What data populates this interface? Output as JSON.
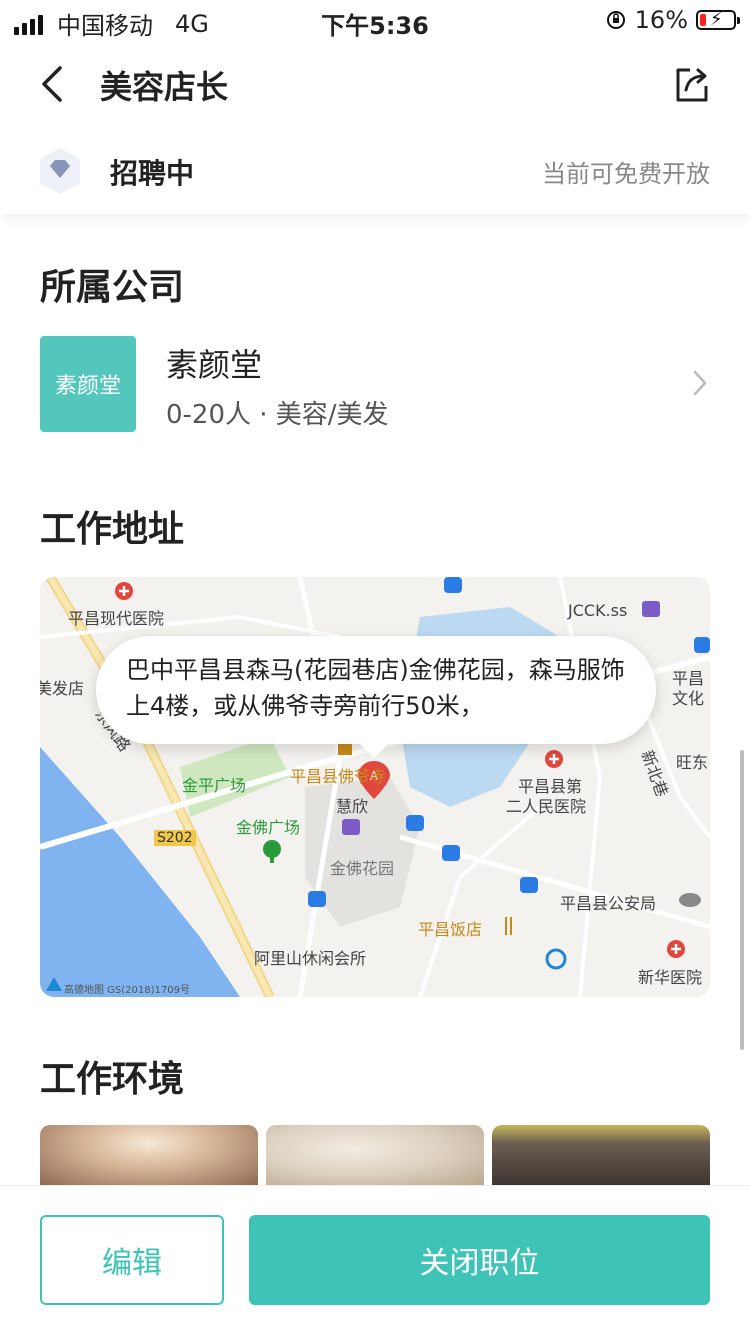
{
  "status_bar": {
    "carrier": "中国移动",
    "network": "4G",
    "time": "下午5:36",
    "battery": "16%"
  },
  "header": {
    "title": "美容店长"
  },
  "recruit": {
    "status": "招聘中",
    "note": "当前可免费开放"
  },
  "company_section": {
    "title": "所属公司",
    "logo_text": "素颜堂",
    "name": "素颜堂",
    "meta": "0-20人 · 美容/美发"
  },
  "address_section": {
    "title": "工作地址",
    "address": "巴中平昌县森马(花园巷店)金佛花园，森马服饰上4楼，或从佛爷寺旁前行50米，",
    "map_labels": {
      "hospital1": "平昌现代医院",
      "jcck": "JCCK.ss",
      "beauty": "美发店",
      "pingchang_culture": "平昌文化",
      "dongfeng_road": "东风路",
      "xinbei_lane": "新北巷",
      "wangdong": "旺东",
      "jinping_square": "金平广场",
      "foyesi": "平昌县佛爷寺",
      "huixin": "慧欣",
      "hospital2_line1": "平昌县第",
      "hospital2_line2": "二人民医院",
      "jinfo_square": "金佛广场",
      "jinfo_garden": "金佛花园",
      "s202": "S202",
      "police": "平昌县公安局",
      "restaurant": "平昌饭店",
      "club": "阿里山休闲会所",
      "xinhua_hospital": "新华医院",
      "copyright": "高德地图 GS(2018)1709号"
    }
  },
  "environment_section": {
    "title": "工作环境"
  },
  "actions": {
    "edit": "编辑",
    "close": "关闭职位"
  },
  "colors": {
    "accent": "#3ec3b7",
    "logo_bg": "#54c7bd"
  }
}
